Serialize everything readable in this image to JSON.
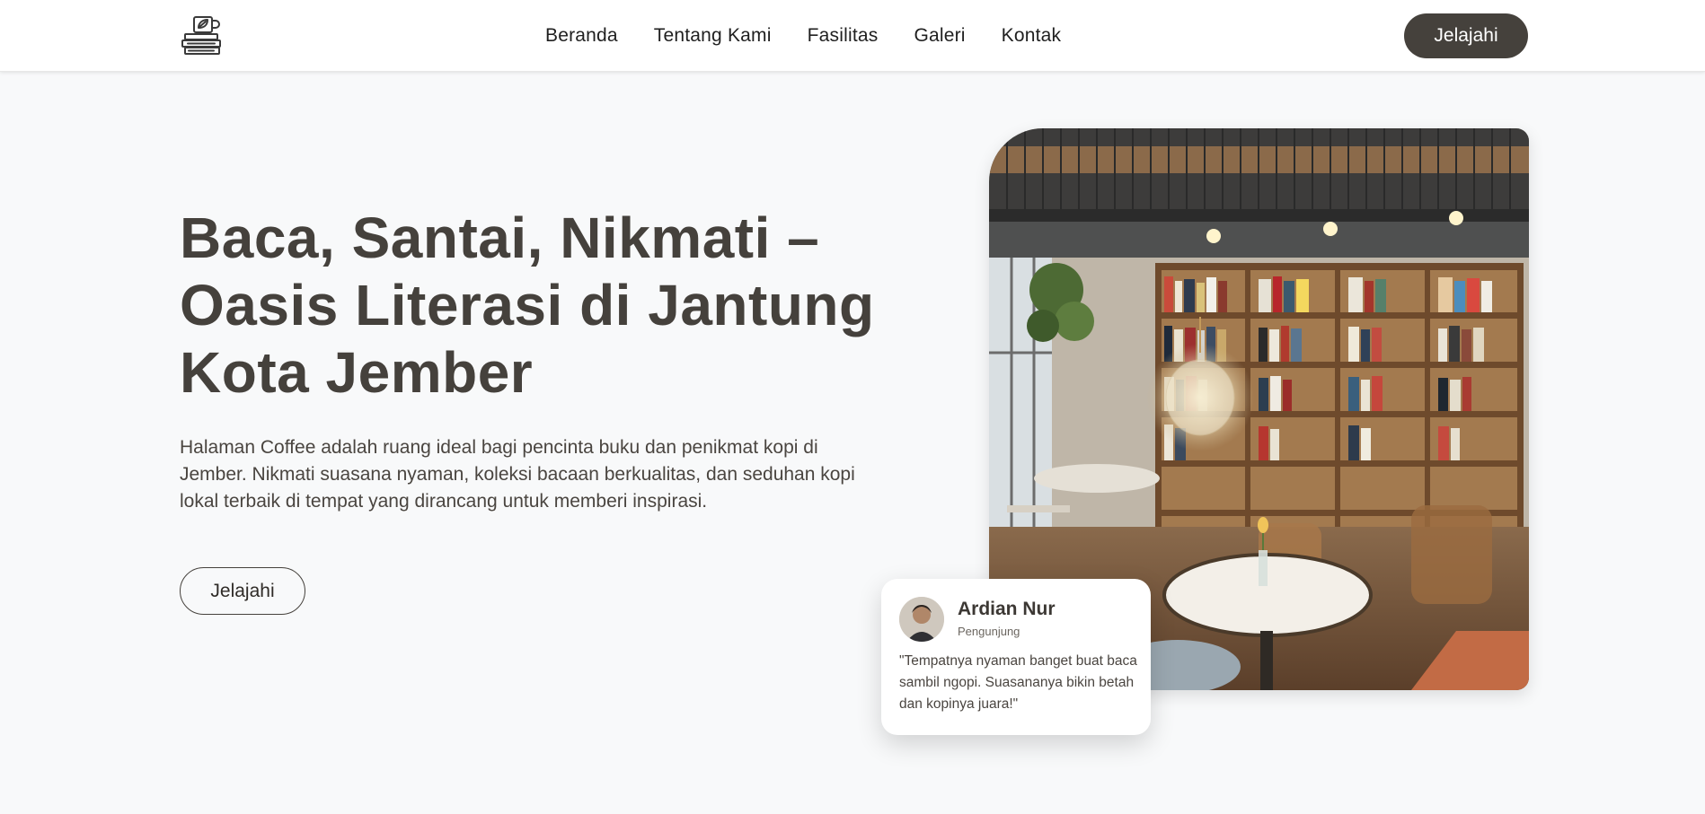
{
  "nav": {
    "links": [
      "Beranda",
      "Tentang Kami",
      "Fasilitas",
      "Galeri",
      "Kontak"
    ],
    "cta_label": "Jelajahi",
    "logo_icon": "coffee-books-logo-icon"
  },
  "hero": {
    "title": "Baca, Santai, Nikmati – Oasis Literasi di Jantung Kota Jember",
    "description": "Halaman Coffee adalah ruang ideal bagi pencinta buku dan penikmat kopi di Jember. Nikmati suasana nyaman, koleksi bacaan berkualitas, dan seduhan kopi lokal terbaik di tempat yang dirancang untuk memberi inspirasi.",
    "button_label": "Jelajahi"
  },
  "testimonial": {
    "name": "Ardian Nur",
    "role": "Pengunjung",
    "quote": "\"Tempatnya nyaman banget buat baca sambil ngopi. Suasananya bikin betah dan kopinya juara!\""
  },
  "colors": {
    "primary": "#45413c",
    "background": "#f8f9fa",
    "surface": "#ffffff"
  }
}
